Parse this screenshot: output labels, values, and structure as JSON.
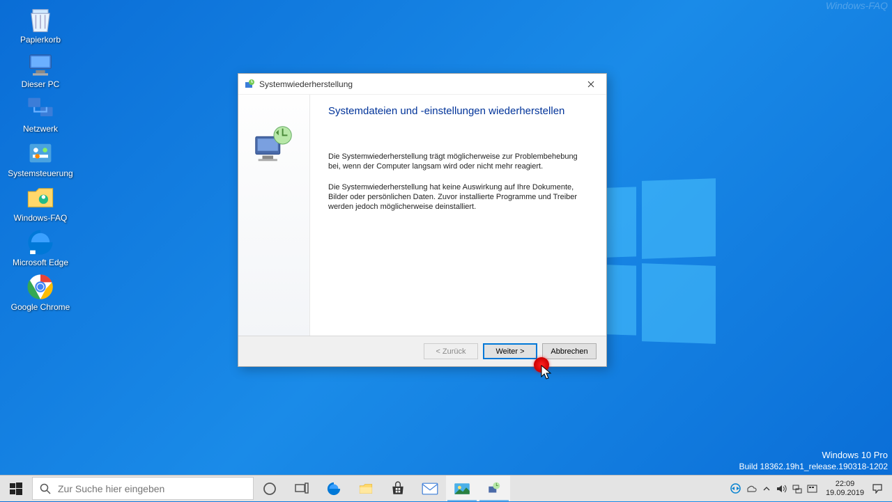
{
  "desktop_icons": [
    {
      "name": "recycle-bin",
      "label": "Papierkorb"
    },
    {
      "name": "this-pc",
      "label": "Dieser PC"
    },
    {
      "name": "network",
      "label": "Netzwerk"
    },
    {
      "name": "control-panel",
      "label": "Systemsteuerung"
    },
    {
      "name": "windows-faq",
      "label": "Windows-FAQ"
    },
    {
      "name": "edge",
      "label": "Microsoft Edge"
    },
    {
      "name": "chrome",
      "label": "Google Chrome"
    }
  ],
  "watermark": {
    "top": "Windows-FAQ",
    "line1": "Windows 10 Pro",
    "line2": "Build 18362.19h1_release.190318-1202"
  },
  "dialog": {
    "title": "Systemwiederherstellung",
    "heading": "Systemdateien und -einstellungen wiederherstellen",
    "para1": "Die Systemwiederherstellung trägt möglicherweise zur Problembehebung bei, wenn der Computer langsam wird oder nicht mehr reagiert.",
    "para2": "Die Systemwiederherstellung hat keine Auswirkung auf Ihre Dokumente, Bilder oder persönlichen Daten. Zuvor installierte Programme und Treiber werden jedoch möglicherweise deinstalliert.",
    "back": "< Zurück",
    "next": "Weiter >",
    "cancel": "Abbrechen"
  },
  "taskbar": {
    "search_placeholder": "Zur Suche hier eingeben",
    "time": "22:09",
    "date": "19.09.2019"
  }
}
